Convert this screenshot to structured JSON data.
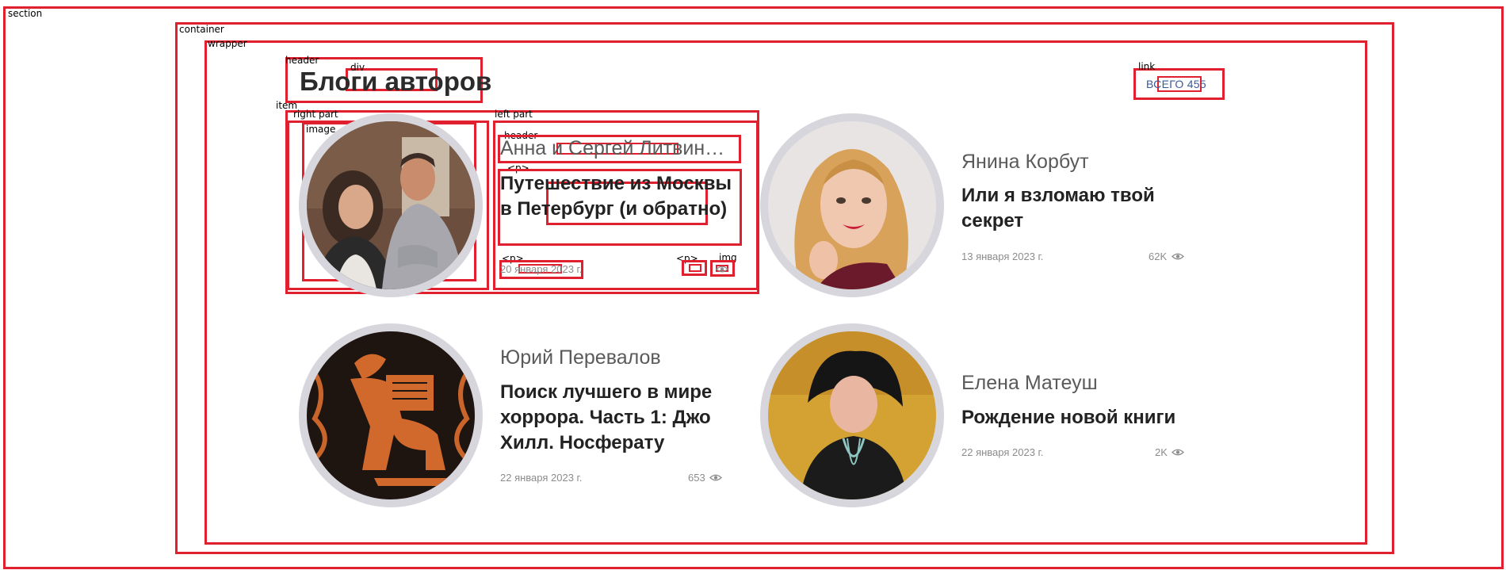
{
  "debug_labels": {
    "section": "section",
    "container": "container",
    "wrapper": "wrapper",
    "header": "header",
    "div": "div",
    "link": "link",
    "item": "item",
    "right_part": "right part",
    "left_part": "left part",
    "image": "image",
    "card_header": "header",
    "p1": "<p>",
    "p2": "<p>",
    "p3": "<p>",
    "img": "img",
    "inner_div": "div"
  },
  "page": {
    "title": "Блоги авторов",
    "total_link": "ВСЕГО 455"
  },
  "posts": [
    {
      "author": "Анна и Сергей Литвин…",
      "title": "Путешествие из Москвы в Петербург (и обратно)",
      "date": "20 января 2023 г.",
      "views": ""
    },
    {
      "author": "Янина Корбут",
      "title": "Или я взломаю твой секрет",
      "date": "13 января 2023 г.",
      "views": "62K"
    },
    {
      "author": "Юрий Перевалов",
      "title": "Поиск лучшего в мире хоррора. Часть 1: Джо Хилл. Носферату",
      "date": "22 января 2023 г.",
      "views": "653"
    },
    {
      "author": "Елена Матеуш",
      "title": "Рождение новой книги",
      "date": "22 января 2023 г.",
      "views": "2K"
    }
  ],
  "colors": {
    "debug": "#e0202e",
    "link": "#3a5a9a",
    "avatar_ring": "#d6d6dc"
  },
  "icons": {
    "views": "eye-icon"
  }
}
